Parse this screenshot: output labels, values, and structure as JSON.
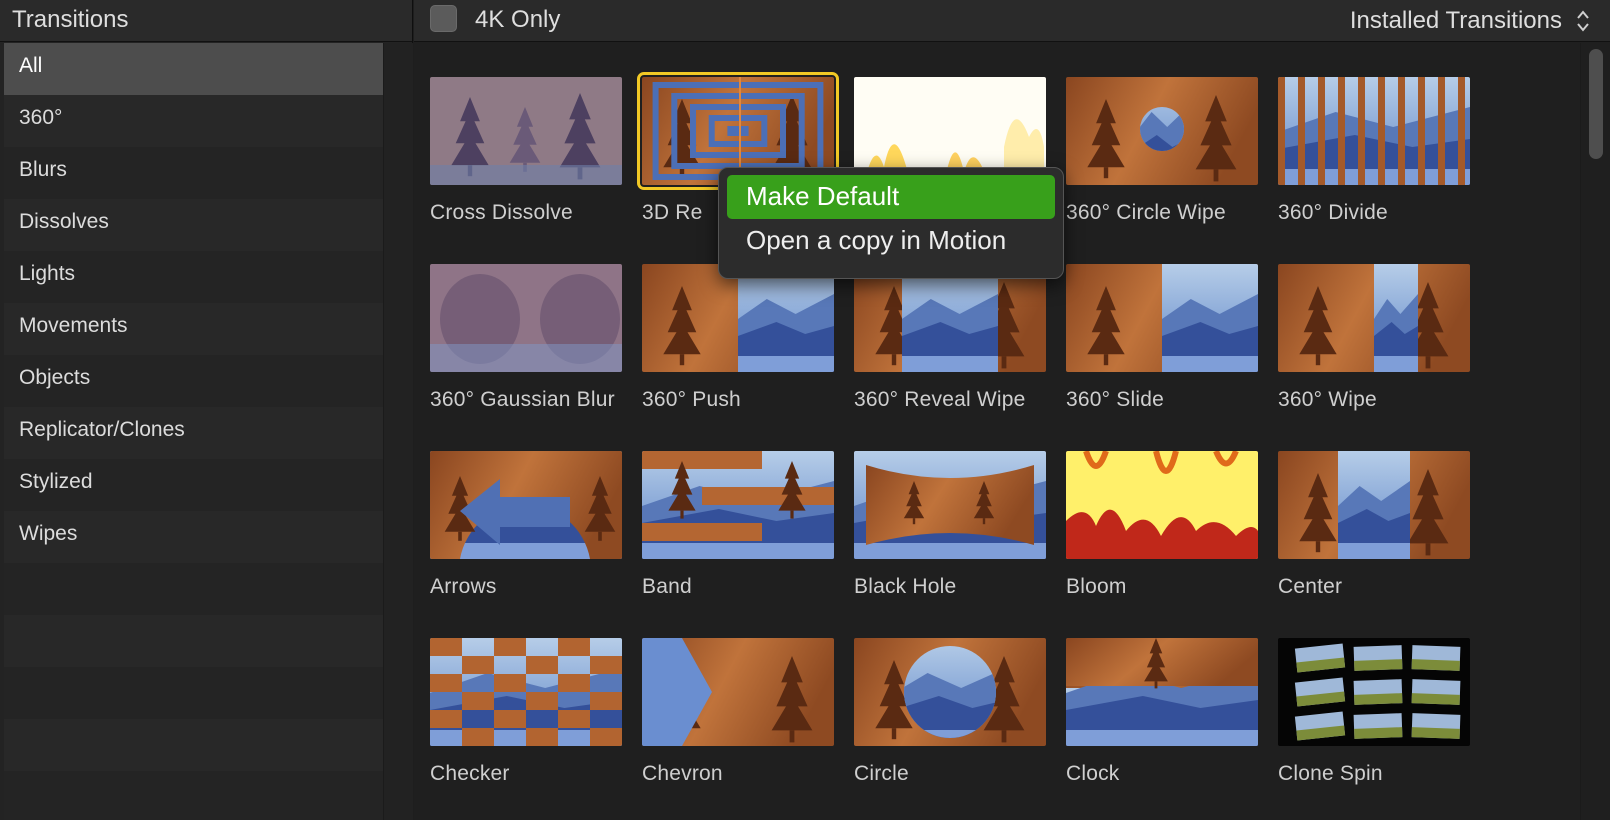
{
  "sidebar": {
    "title": "Transitions",
    "items": [
      {
        "label": "All",
        "selected": true
      },
      {
        "label": "360°"
      },
      {
        "label": "Blurs"
      },
      {
        "label": "Dissolves"
      },
      {
        "label": "Lights"
      },
      {
        "label": "Movements"
      },
      {
        "label": "Objects"
      },
      {
        "label": "Replicator/Clones"
      },
      {
        "label": "Stylized"
      },
      {
        "label": "Wipes"
      }
    ]
  },
  "toolbar": {
    "checkbox_label": "4K Only",
    "checkbox_checked": false,
    "source_menu_label": "Installed Transitions"
  },
  "grid": {
    "tiles": [
      {
        "name": "Cross Dissolve",
        "thumb": "dissolve"
      },
      {
        "name": "3D Re",
        "thumb": "rectangles",
        "selected": true
      },
      {
        "name": "",
        "thumb": "fire-white"
      },
      {
        "name": "360° Circle Wipe",
        "thumb": "circle-small"
      },
      {
        "name": "360° Divide",
        "thumb": "divide"
      },
      {
        "name": "360° Gaussian Blur",
        "thumb": "blur"
      },
      {
        "name": "360° Push",
        "thumb": "split-right"
      },
      {
        "name": "360° Reveal Wipe",
        "thumb": "split-center"
      },
      {
        "name": "360° Slide",
        "thumb": "split-right"
      },
      {
        "name": "360° Wipe",
        "thumb": "split-narrow"
      },
      {
        "name": "Arrows",
        "thumb": "arrows"
      },
      {
        "name": "Band",
        "thumb": "band"
      },
      {
        "name": "Black Hole",
        "thumb": "bowtie"
      },
      {
        "name": "Bloom",
        "thumb": "bloom"
      },
      {
        "name": "Center",
        "thumb": "center"
      },
      {
        "name": "Checker",
        "thumb": "checker"
      },
      {
        "name": "Chevron",
        "thumb": "chevron"
      },
      {
        "name": "Circle",
        "thumb": "circle-big"
      },
      {
        "name": "Clock",
        "thumb": "clock"
      },
      {
        "name": "Clone Spin",
        "thumb": "clonespin"
      }
    ]
  },
  "context_menu": {
    "items": [
      {
        "label": "Make Default",
        "highlighted": true
      },
      {
        "label": "Open a copy in Motion"
      }
    ]
  },
  "colors": {
    "accent_green": "#38a01b",
    "selection_yellow": "#f2c925",
    "wood": "#9a4f24",
    "sky_blue": "#6f93d0"
  }
}
